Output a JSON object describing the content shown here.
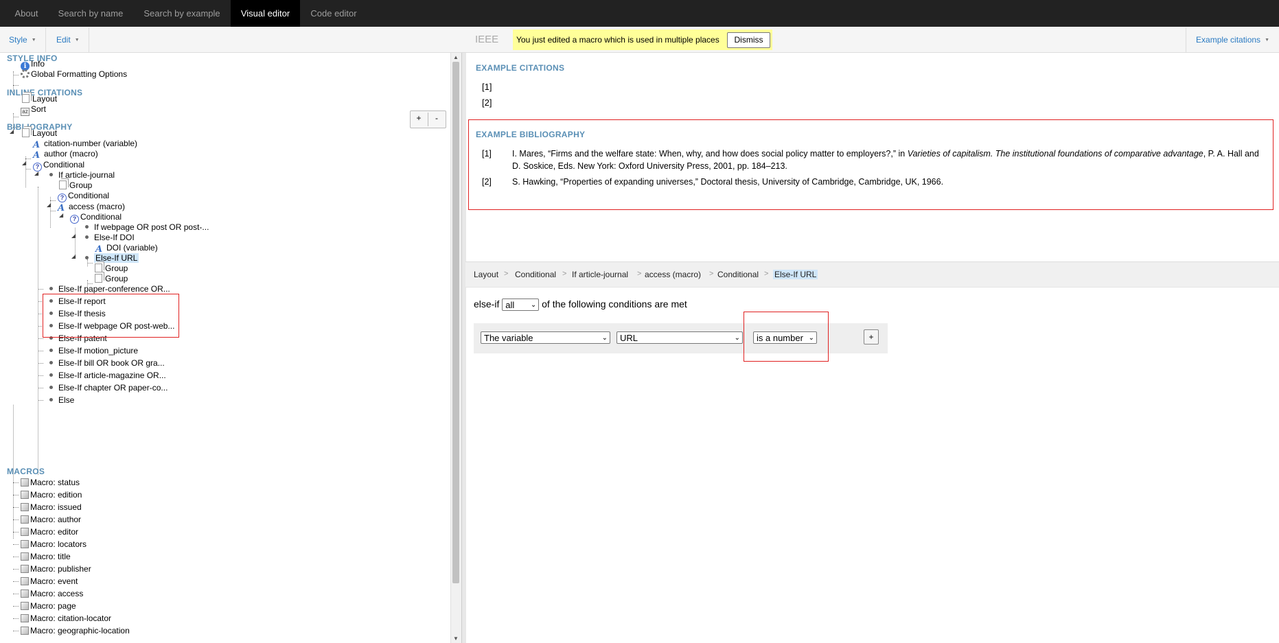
{
  "nav": {
    "tabs": [
      "About",
      "Search by name",
      "Search by example",
      "Visual editor",
      "Code editor"
    ],
    "active": "Visual editor"
  },
  "toolbar": {
    "style_menu": "Style",
    "edit_menu": "Edit",
    "style_name": "IEEE",
    "notice_text": "You just edited a macro which is used in multiple places",
    "dismiss_label": "Dismiss",
    "example_citations_menu": "Example citations"
  },
  "tree": {
    "sections": {
      "style_info": "STYLE INFO",
      "inline_citations": "INLINE CITATIONS",
      "bibliography": "BIBLIOGRAPHY",
      "macros": "MACROS"
    },
    "style_info": [
      "Info",
      "Global Formatting Options"
    ],
    "inline_citations": [
      "Layout",
      "Sort"
    ],
    "bibliography": {
      "layout": "Layout",
      "citation_number": "citation-number (variable)",
      "author_macro": "author (macro)",
      "conditional": "Conditional",
      "if_article_journal": "If article-journal",
      "group": "Group",
      "inner_conditional": "Conditional",
      "access_macro": "access (macro)",
      "access_conditional": "Conditional",
      "if_webpage": "If webpage OR post OR post-...",
      "elseif_doi": "Else-If DOI",
      "doi_variable": "DOI (variable)",
      "elseif_url": "Else-If URL",
      "group_1": "Group",
      "group_2": "Group",
      "branches": [
        "Else-If paper-conference OR...",
        "Else-If report",
        "Else-If thesis",
        "Else-If webpage OR post-web...",
        "Else-If patent",
        "Else-If motion_picture",
        "Else-If bill OR book OR gra...",
        "Else-If article-magazine OR...",
        "Else-If chapter OR paper-co...",
        "Else"
      ]
    },
    "macros": [
      "Macro: status",
      "Macro: edition",
      "Macro: issued",
      "Macro: author",
      "Macro: editor",
      "Macro: locators",
      "Macro: title",
      "Macro: publisher",
      "Macro: event",
      "Macro: access",
      "Macro: page",
      "Macro: citation-locator",
      "Macro: geographic-location"
    ],
    "zoom_plus": "+",
    "zoom_minus": "-"
  },
  "examples": {
    "citations_heading": "EXAMPLE CITATIONS",
    "citations": [
      "[1]",
      "[2]"
    ],
    "bibliography_heading": "EXAMPLE BIBLIOGRAPHY",
    "bib": [
      {
        "num": "[1]",
        "pre": "I. Mares, “Firms and the welfare state: When, why, and how does social policy matter to employers?,” in ",
        "italic": "Varieties of capitalism. The institutional foundations of comparative advantage",
        "post": ", P. A. Hall and D. Soskice, Eds. New York: Oxford University Press, 2001, pp. 184–213."
      },
      {
        "num": "[2]",
        "pre": "S. Hawking, “Properties of expanding universes,” Doctoral thesis, University of Cambridge, Cambridge, UK, 1966.",
        "italic": "",
        "post": ""
      }
    ]
  },
  "editor": {
    "breadcrumbs": [
      "Layout",
      "Conditional",
      "If article-journal",
      "access (macro)",
      "Conditional",
      "Else-If URL"
    ],
    "separator": ">",
    "condition_prefix": "else-if",
    "match_select": "all",
    "condition_suffix": "of the following conditions are met",
    "row": {
      "type_select": "The variable",
      "variable_select": "URL",
      "test_select": "is a number",
      "add_label": "+"
    }
  }
}
